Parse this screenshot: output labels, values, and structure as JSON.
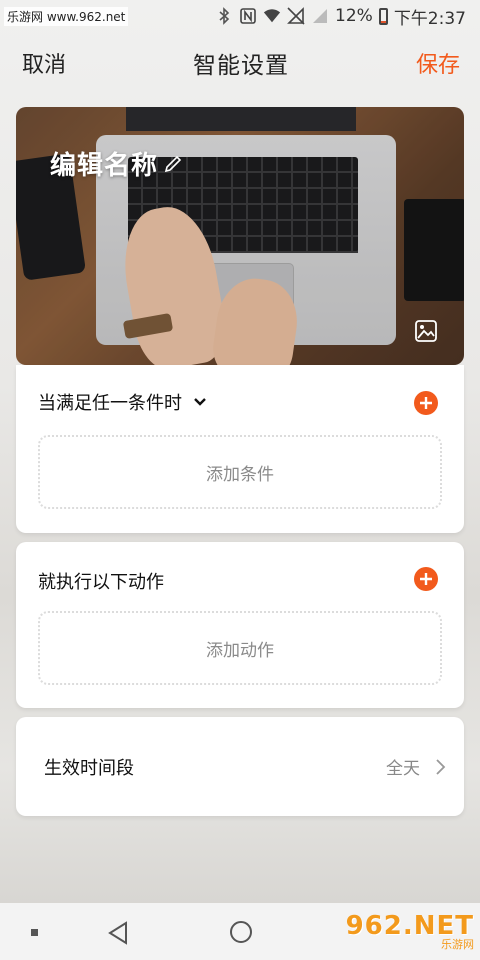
{
  "status_bar": {
    "watermark": "乐游网 www.962.net",
    "battery": "12%",
    "time": "下午2:37",
    "battery_level": 0.12,
    "icons": [
      "bluetooth-icon",
      "nfc-icon",
      "wifi-icon",
      "sim-off-icon",
      "signal-icon",
      "battery-icon"
    ]
  },
  "header": {
    "cancel": "取消",
    "title": "智能设置",
    "save": "保存",
    "accent_color": "#f25a1c"
  },
  "hero": {
    "name": "编辑名称",
    "icons": [
      "pencil-icon",
      "image-icon"
    ]
  },
  "conditions": {
    "heading": "当满足任一条件时",
    "add_placeholder": "添加条件"
  },
  "actions": {
    "heading": "就执行以下动作",
    "add_placeholder": "添加动作"
  },
  "schedule": {
    "label": "生效时间段",
    "value": "全天"
  },
  "nav_bar": {
    "watermark_big": "962.NET",
    "watermark_small": "乐游网"
  }
}
